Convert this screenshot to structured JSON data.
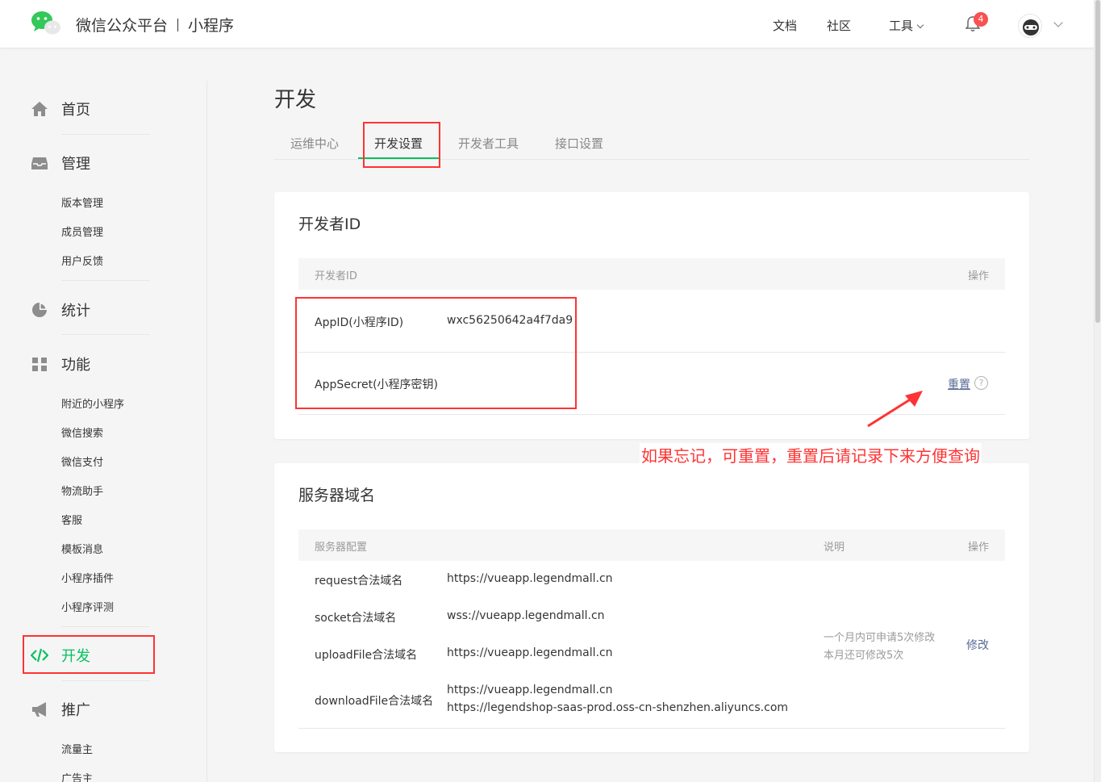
{
  "header": {
    "brand_title": "微信公众平台",
    "brand_sub": "小程序",
    "nav": [
      "文档",
      "社区",
      "工具"
    ],
    "notification_count": "4"
  },
  "sidebar": {
    "home": "首页",
    "manage": {
      "label": "管理",
      "items": [
        "版本管理",
        "成员管理",
        "用户反馈"
      ]
    },
    "stats": "统计",
    "features": {
      "label": "功能",
      "items": [
        "附近的小程序",
        "微信搜索",
        "微信支付",
        "物流助手",
        "客服",
        "模板消息",
        "小程序插件",
        "小程序评测"
      ]
    },
    "develop": "开发",
    "promote": {
      "label": "推广",
      "items": [
        "流量主",
        "广告主"
      ]
    }
  },
  "main": {
    "title": "开发",
    "tabs": [
      "运维中心",
      "开发设置",
      "开发者工具",
      "接口设置"
    ],
    "active_tab": "开发设置",
    "developer_id": {
      "section_title": "开发者ID",
      "col_id": "开发者ID",
      "col_action": "操作",
      "appid_label": "AppID(小程序ID)",
      "appid_value": "wxc56250642a4f7da9",
      "secret_label": "AppSecret(小程序密钥)",
      "reset_link": "重置",
      "help_icon": "?"
    },
    "annotation": "如果忘记，可重置，重置后请记录下来方便查询",
    "server_domain": {
      "section_title": "服务器域名",
      "col_config": "服务器配置",
      "col_desc": "说明",
      "col_action": "操作",
      "rows": [
        {
          "label": "request合法域名",
          "values": [
            "https://vueapp.legendmall.cn"
          ]
        },
        {
          "label": "socket合法域名",
          "values": [
            "wss://vueapp.legendmall.cn"
          ]
        },
        {
          "label": "uploadFile合法域名",
          "values": [
            "https://vueapp.legendmall.cn"
          ]
        },
        {
          "label": "downloadFile合法域名",
          "values": [
            "https://vueapp.legendmall.cn",
            "https://legendshop-saas-prod.oss-cn-shenzhen.aliyuncs.com"
          ]
        }
      ],
      "desc_line1": "一个月内可申请5次修改",
      "desc_line2": "本月还可修改5次",
      "modify_link": "修改"
    }
  },
  "colors": {
    "accent": "#07c160",
    "link": "#576b95",
    "annotation": "#ff3333",
    "badge": "#fa5151"
  }
}
